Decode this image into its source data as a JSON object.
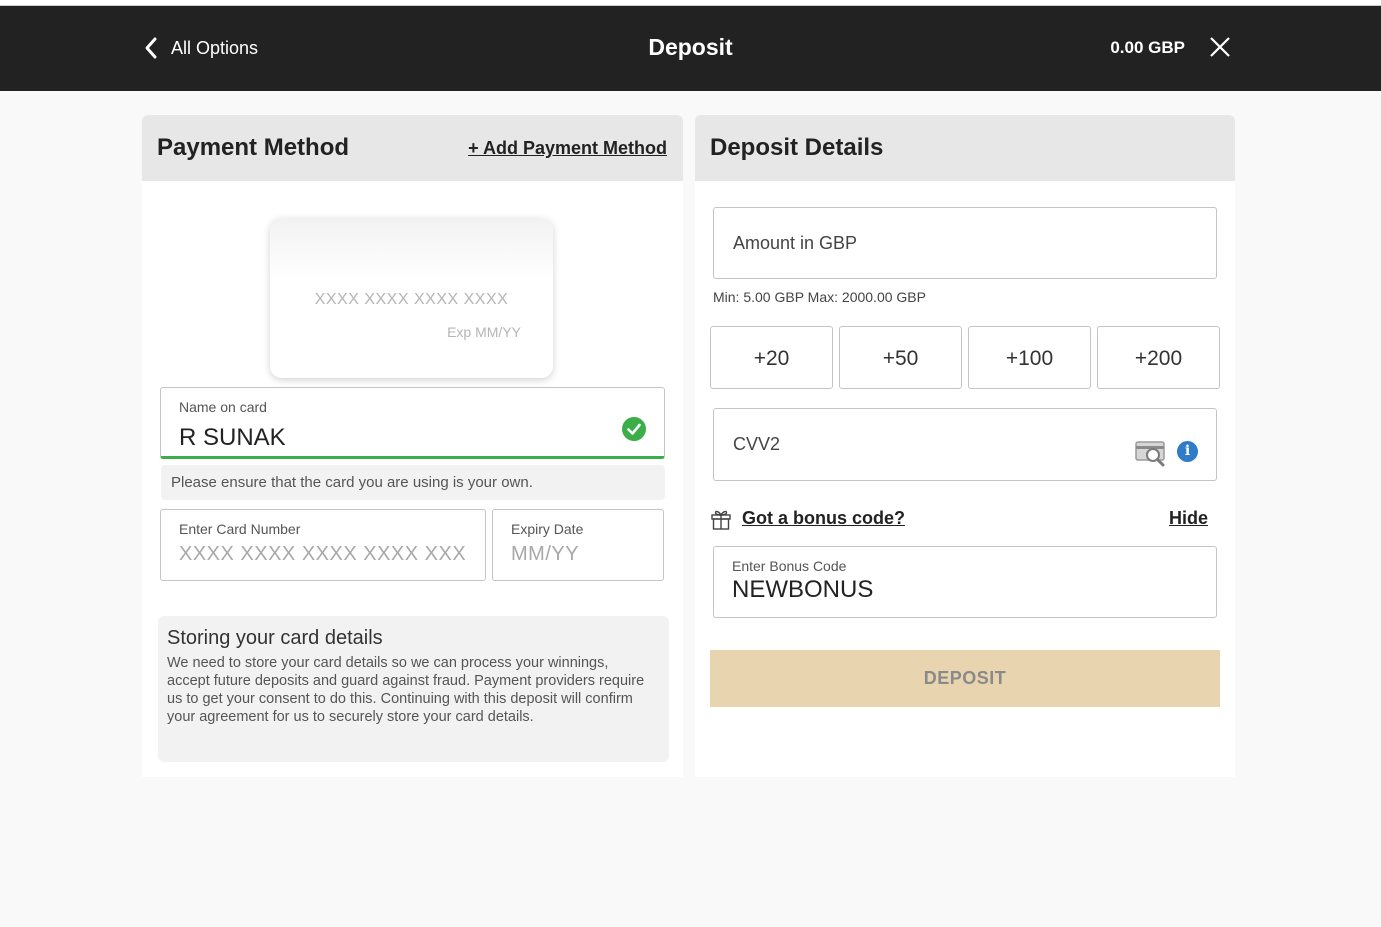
{
  "header": {
    "back_label": "All Options",
    "title": "Deposit",
    "balance": "0.00 GBP"
  },
  "payment_method": {
    "title": "Payment Method",
    "add_label": "+ Add Payment Method",
    "card_preview": {
      "number_placeholder": "XXXX XXXX XXXX XXXX",
      "exp_placeholder": "Exp MM/YY"
    },
    "name_field": {
      "label": "Name on card",
      "value": "R SUNAK"
    },
    "notice": "Please ensure that the card you are using is your own.",
    "card_number_field": {
      "label": "Enter Card Number",
      "placeholder": "XXXX XXXX XXXX XXXX XXX"
    },
    "expiry_field": {
      "label": "Expiry Date",
      "placeholder": "MM/YY"
    },
    "storing": {
      "heading": "Storing your card details",
      "body": "We need to store your card details so we can process your winnings, accept future deposits and guard against fraud. Payment providers require us to get your consent to do this. Continuing with this deposit will confirm your agreement for us to securely store your card details."
    }
  },
  "deposit_details": {
    "title": "Deposit Details",
    "amount_placeholder": "Amount in GBP",
    "limits": "Min: 5.00 GBP Max: 2000.00 GBP",
    "quick_amounts": [
      "+20",
      "+50",
      "+100",
      "+200"
    ],
    "cvv_placeholder": "CVV2",
    "info_glyph": "i",
    "bonus_question": "Got a bonus code?",
    "hide_label": "Hide",
    "bonus_field": {
      "label": "Enter Bonus Code",
      "value": "NEWBONUS"
    },
    "deposit_button": "DEPOSIT"
  },
  "colors": {
    "header_bg": "#222222",
    "valid_green": "#3cae49",
    "deposit_button_bg": "#e9d4b0",
    "info_blue": "#2f7cc9"
  },
  "icons": [
    "chevron-left-icon",
    "close-icon",
    "check-circle-icon",
    "card-scan-icon",
    "info-icon",
    "gift-icon"
  ]
}
